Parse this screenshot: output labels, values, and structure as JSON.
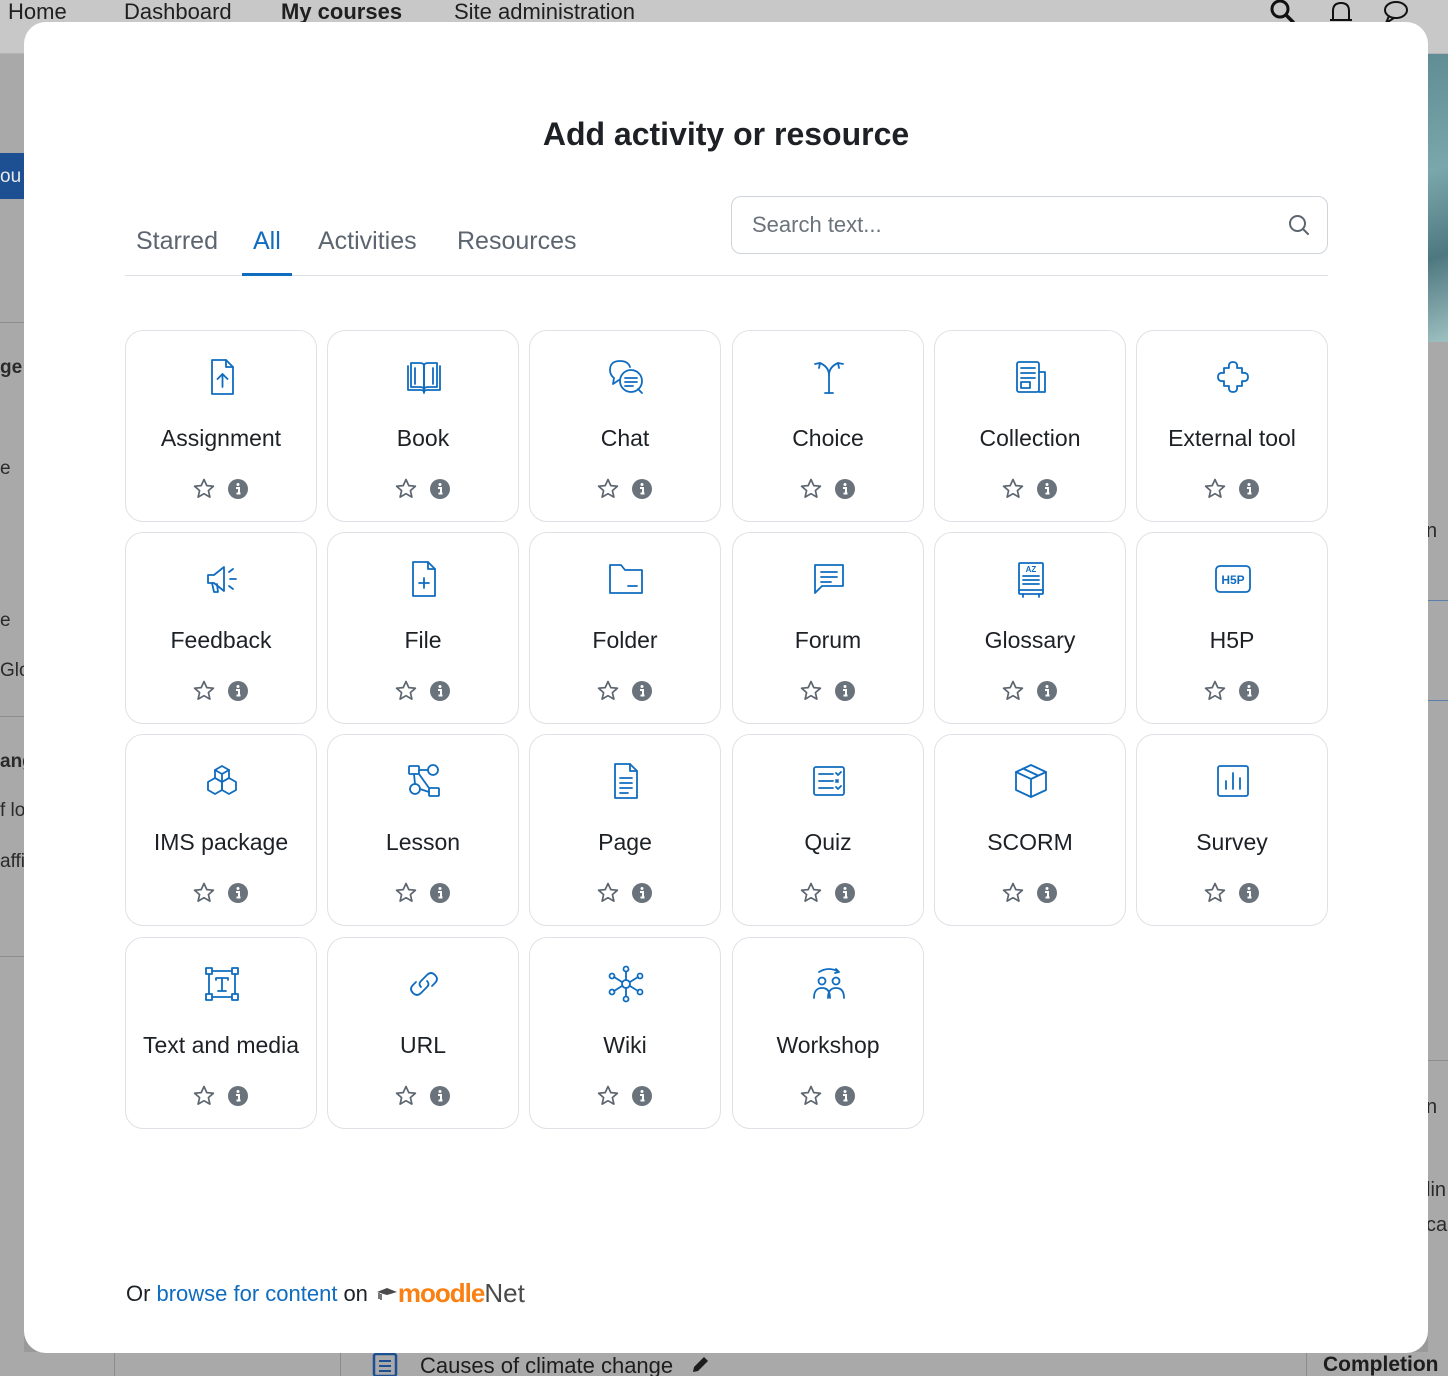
{
  "nav": {
    "items": [
      "Home",
      "Dashboard",
      "My courses",
      "Site administration"
    ],
    "icons": [
      "search-icon",
      "bell-icon",
      "chat-bubble-icon"
    ]
  },
  "background": {
    "left_fragments": [
      "ou",
      "ge",
      "e",
      "e",
      "Glol",
      "ang",
      "f lo",
      "affi"
    ],
    "right_fragments": [
      "n",
      "n",
      "lin",
      "ca"
    ],
    "bottom_title": "Causes of climate change",
    "completion": "Completion"
  },
  "modal": {
    "title": "Add activity or resource",
    "tabs": [
      {
        "label": "Starred",
        "active": false
      },
      {
        "label": "All",
        "active": true
      },
      {
        "label": "Activities",
        "active": false
      },
      {
        "label": "Resources",
        "active": false
      }
    ],
    "search": {
      "placeholder": "Search text..."
    },
    "items": [
      {
        "label": "Assignment",
        "icon": "assignment-icon"
      },
      {
        "label": "Book",
        "icon": "book-icon"
      },
      {
        "label": "Chat",
        "icon": "chat-icon"
      },
      {
        "label": "Choice",
        "icon": "choice-icon"
      },
      {
        "label": "Collection",
        "icon": "collection-icon"
      },
      {
        "label": "External tool",
        "icon": "puzzle-icon"
      },
      {
        "label": "Feedback",
        "icon": "megaphone-icon"
      },
      {
        "label": "File",
        "icon": "file-icon"
      },
      {
        "label": "Folder",
        "icon": "folder-icon"
      },
      {
        "label": "Forum",
        "icon": "forum-icon"
      },
      {
        "label": "Glossary",
        "icon": "glossary-icon"
      },
      {
        "label": "H5P",
        "icon": "h5p-icon"
      },
      {
        "label": "IMS package",
        "icon": "cubes-icon"
      },
      {
        "label": "Lesson",
        "icon": "lesson-icon"
      },
      {
        "label": "Page",
        "icon": "page-icon"
      },
      {
        "label": "Quiz",
        "icon": "quiz-icon"
      },
      {
        "label": "SCORM",
        "icon": "box-icon"
      },
      {
        "label": "Survey",
        "icon": "survey-icon"
      },
      {
        "label": "Text and media",
        "icon": "text-media-icon"
      },
      {
        "label": "URL",
        "icon": "link-icon"
      },
      {
        "label": "Wiki",
        "icon": "wiki-icon"
      },
      {
        "label": "Workshop",
        "icon": "workshop-icon"
      }
    ],
    "footer": {
      "prefix": "Or",
      "link": "browse for content",
      "middle": "on",
      "brand_moodle": "moodle",
      "brand_net": "Net"
    }
  },
  "colors": {
    "accent": "#0f6cbf",
    "icon": "#0f6cbf",
    "text": "#1d2125",
    "muted": "#5d6670",
    "border": "#dee2e6",
    "brand_orange": "#f98012"
  }
}
